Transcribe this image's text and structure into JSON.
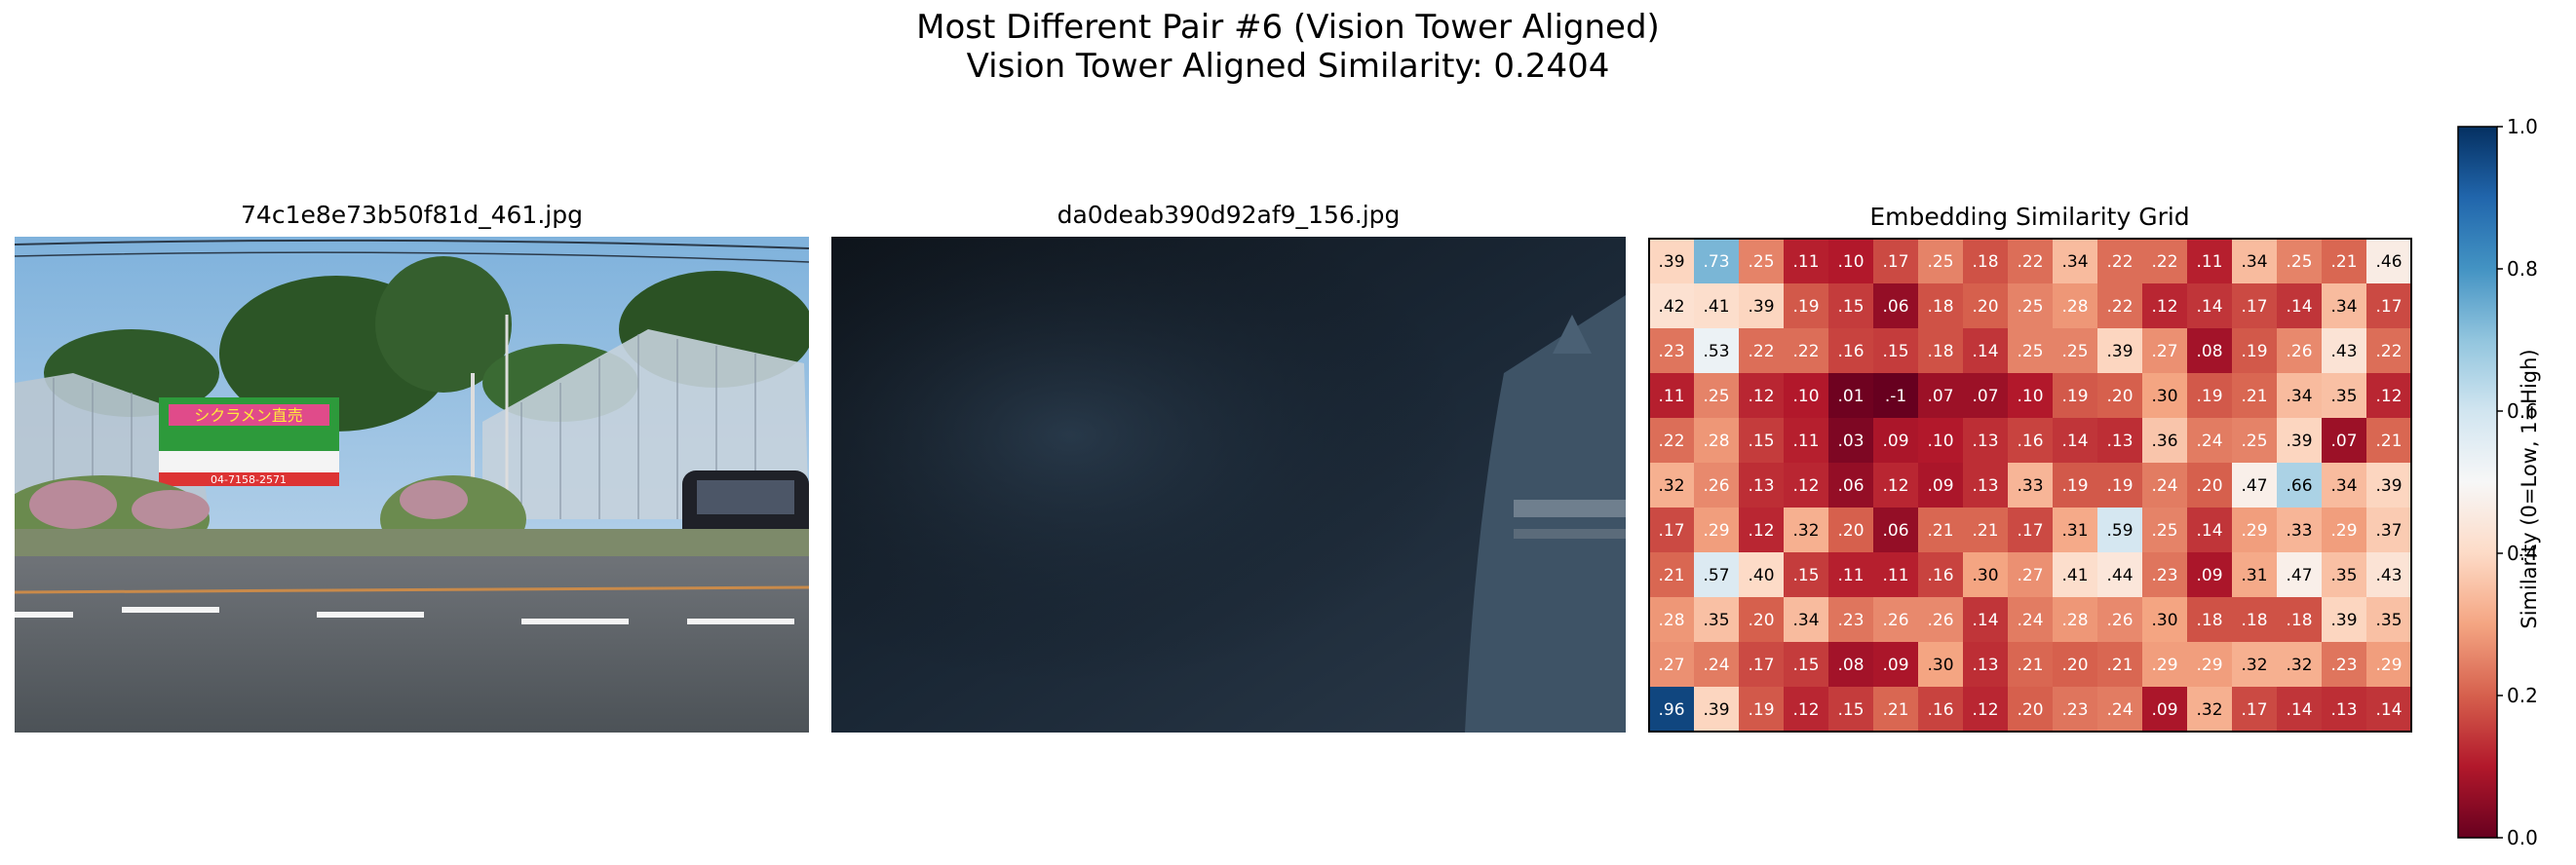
{
  "figure": {
    "title_line1": "Most Different Pair #6 (Vision Tower Aligned)",
    "title_line2": "Vision Tower Aligned Similarity: 0.2404"
  },
  "panels": {
    "left_image_title": "74c1e8e73b50f81d_461.jpg",
    "middle_image_title": "da0deab390d92af9_156.jpg",
    "grid_title": "Embedding Similarity Grid"
  },
  "photo1": {
    "description_icon": "greenhouse-street-photo",
    "sign_text": "シクラメン直売",
    "sign_phone": "04-7158-2571"
  },
  "photo2": {
    "description_icon": "dark-car-window-photo"
  },
  "chart_data": {
    "type": "heatmap",
    "title": "Embedding Similarity Grid",
    "cmap": "RdBu",
    "vmin": 0,
    "vmax": 1,
    "colorbar_label": "Similarity (0=Low, 1=High)",
    "colorbar_ticks": [
      "0.0",
      "0.2",
      "0.4",
      "0.6",
      "0.8",
      "1.0"
    ],
    "rows": 11,
    "cols": 16,
    "values": [
      [
        0.39,
        0.73,
        0.25,
        0.11,
        0.1,
        0.17,
        0.25,
        0.18,
        0.22,
        0.34,
        0.22,
        0.22,
        0.11,
        0.34,
        0.25,
        0.21,
        0.46
      ],
      [
        0.42,
        0.41,
        0.39,
        0.19,
        0.15,
        0.06,
        0.18,
        0.2,
        0.25,
        0.28,
        0.22,
        0.12,
        0.14,
        0.17,
        0.14,
        0.34,
        0.17
      ],
      [
        0.23,
        0.53,
        0.22,
        0.22,
        0.16,
        0.15,
        0.18,
        0.14,
        0.25,
        0.25,
        0.39,
        0.27,
        0.08,
        0.19,
        0.26,
        0.43,
        0.22
      ],
      [
        0.11,
        0.25,
        0.12,
        0.1,
        0.01,
        -0.1,
        0.07,
        0.07,
        0.1,
        0.19,
        0.2,
        0.3,
        0.19,
        0.21,
        0.34,
        0.35,
        0.12
      ],
      [
        0.22,
        0.28,
        0.15,
        0.11,
        0.03,
        0.09,
        0.1,
        0.13,
        0.16,
        0.14,
        0.13,
        0.36,
        0.24,
        0.25,
        0.39,
        0.07,
        0.21
      ],
      [
        0.32,
        0.26,
        0.13,
        0.12,
        0.06,
        0.12,
        0.09,
        0.13,
        0.33,
        0.19,
        0.19,
        0.24,
        0.2,
        0.47,
        0.66,
        0.34,
        0.39
      ],
      [
        0.17,
        0.29,
        0.12,
        0.32,
        0.2,
        0.06,
        0.21,
        0.21,
        0.17,
        0.31,
        0.59,
        0.25,
        0.14,
        0.29,
        0.33,
        0.29,
        0.37
      ],
      [
        0.21,
        0.57,
        0.4,
        0.15,
        0.11,
        0.11,
        0.16,
        0.3,
        0.27,
        0.41,
        0.44,
        0.23,
        0.09,
        0.31,
        0.47,
        0.35,
        0.43
      ],
      [
        0.28,
        0.35,
        0.2,
        0.34,
        0.23,
        0.26,
        0.26,
        0.14,
        0.24,
        0.28,
        0.26,
        0.3,
        0.18,
        0.18,
        0.18,
        0.39,
        0.35
      ],
      [
        0.27,
        0.24,
        0.17,
        0.15,
        0.08,
        0.09,
        0.3,
        0.13,
        0.21,
        0.2,
        0.21,
        0.29,
        0.29,
        0.32,
        0.32,
        0.23,
        0.29
      ],
      [
        0.96,
        0.39,
        0.19,
        0.12,
        0.15,
        0.21,
        0.16,
        0.12,
        0.2,
        0.23,
        0.24,
        0.09,
        0.32,
        0.17,
        0.14,
        0.13,
        0.14
      ]
    ],
    "labels": [
      [
        ".39",
        ".73",
        ".25",
        ".11",
        ".10",
        ".17",
        ".25",
        ".18",
        ".22",
        ".34",
        ".22",
        ".22",
        ".11",
        ".34",
        ".25",
        ".21",
        ".46"
      ],
      [
        ".42",
        ".41",
        ".39",
        ".19",
        ".15",
        ".06",
        ".18",
        ".20",
        ".25",
        ".28",
        ".22",
        ".12",
        ".14",
        ".17",
        ".14",
        ".34",
        ".17"
      ],
      [
        ".23",
        ".53",
        ".22",
        ".22",
        ".16",
        ".15",
        ".18",
        ".14",
        ".25",
        ".25",
        ".39",
        ".27",
        ".08",
        ".19",
        ".26",
        ".43",
        ".22"
      ],
      [
        ".11",
        ".25",
        ".12",
        ".10",
        ".01",
        ".-1",
        ".07",
        ".07",
        ".10",
        ".19",
        ".20",
        ".30",
        ".19",
        ".21",
        ".34",
        ".35",
        ".12"
      ],
      [
        ".22",
        ".28",
        ".15",
        ".11",
        ".03",
        ".09",
        ".10",
        ".13",
        ".16",
        ".14",
        ".13",
        ".36",
        ".24",
        ".25",
        ".39",
        ".07",
        ".21"
      ],
      [
        ".32",
        ".26",
        ".13",
        ".12",
        ".06",
        ".12",
        ".09",
        ".13",
        ".33",
        ".19",
        ".19",
        ".24",
        ".20",
        ".47",
        ".66",
        ".34",
        ".39"
      ],
      [
        ".17",
        ".29",
        ".12",
        ".32",
        ".20",
        ".06",
        ".21",
        ".21",
        ".17",
        ".31",
        ".59",
        ".25",
        ".14",
        ".29",
        ".33",
        ".29",
        ".37"
      ],
      [
        ".21",
        ".57",
        ".40",
        ".15",
        ".11",
        ".11",
        ".16",
        ".30",
        ".27",
        ".41",
        ".44",
        ".23",
        ".09",
        ".31",
        ".47",
        ".35",
        ".43"
      ],
      [
        ".28",
        ".35",
        ".20",
        ".34",
        ".23",
        ".26",
        ".26",
        ".14",
        ".24",
        ".28",
        ".26",
        ".30",
        ".18",
        ".18",
        ".18",
        ".39",
        ".35"
      ],
      [
        ".27",
        ".24",
        ".17",
        ".15",
        ".08",
        ".09",
        ".30",
        ".13",
        ".21",
        ".20",
        ".21",
        ".29",
        ".29",
        ".32",
        ".32",
        ".23",
        ".29"
      ],
      [
        ".96",
        ".39",
        ".19",
        ".12",
        ".15",
        ".21",
        ".16",
        ".12",
        ".20",
        ".23",
        ".24",
        ".09",
        ".32",
        ".17",
        ".14",
        ".13",
        ".14"
      ]
    ]
  }
}
